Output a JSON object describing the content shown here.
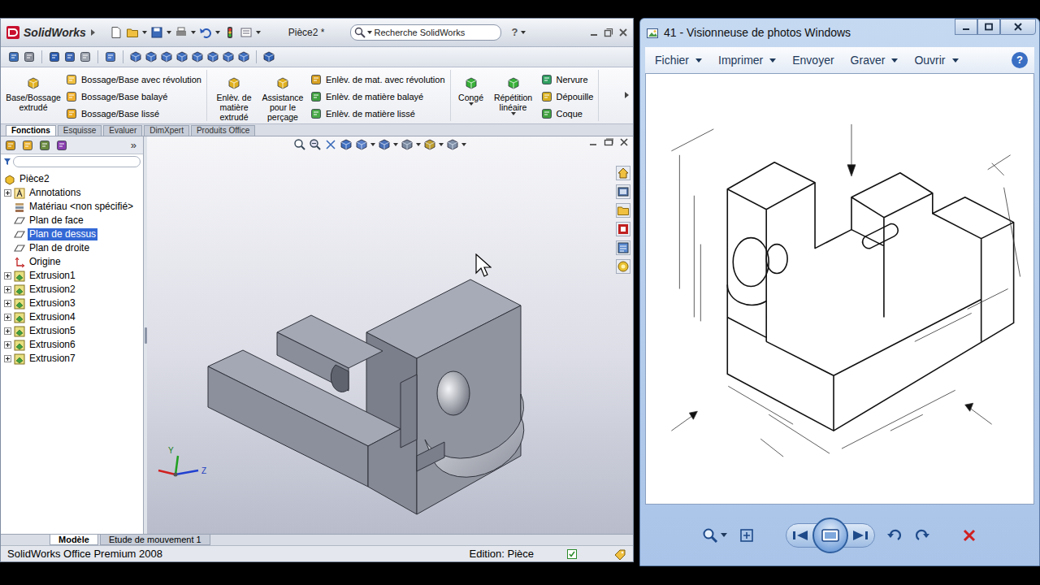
{
  "solidworks": {
    "logo": "SolidWorks",
    "document_title": "Pièce2 *",
    "search": {
      "placeholder": "Recherche SolidWorks"
    },
    "help": "?",
    "ribbon": [
      {
        "large": [
          "Base/Bossage extrudé"
        ],
        "small": [
          "Bossage/Base avec révolution",
          "Bossage/Base balayé",
          "Bossage/Base lissé"
        ]
      },
      {
        "large": [
          "Enlèv. de matière extrudé",
          "Assistance pour le perçage"
        ],
        "small": [
          "Enlèv. de mat. avec révolution",
          "Enlèv. de matière balayé",
          "Enlèv. de matière lissé"
        ]
      },
      {
        "large": [
          "Congé",
          "Répétition linéaire"
        ],
        "small": [
          "Nervure",
          "Dépouille",
          "Coque"
        ]
      }
    ],
    "tabs": [
      {
        "label": "Fonctions",
        "selected": true
      },
      {
        "label": "Esquisse",
        "selected": false
      },
      {
        "label": "Evaluer",
        "selected": false
      },
      {
        "label": "DimXpert",
        "selected": false
      },
      {
        "label": "Produits Office",
        "selected": false
      }
    ],
    "panel_more": "»",
    "feature_tree": {
      "root": "Pièce2",
      "items": [
        {
          "label": "Annotations",
          "kind": "annotations",
          "expandable": true,
          "selected": false
        },
        {
          "label": "Matériau <non spécifié>",
          "kind": "material",
          "expandable": false,
          "selected": false
        },
        {
          "label": "Plan de face",
          "kind": "plane",
          "expandable": false,
          "selected": false
        },
        {
          "label": "Plan de dessus",
          "kind": "plane",
          "expandable": false,
          "selected": true
        },
        {
          "label": "Plan de droite",
          "kind": "plane",
          "expandable": false,
          "selected": false
        },
        {
          "label": "Origine",
          "kind": "origin",
          "expandable": false,
          "selected": false
        },
        {
          "label": "Extrusion1",
          "kind": "feature",
          "expandable": true,
          "selected": false
        },
        {
          "label": "Extrusion2",
          "kind": "feature",
          "expandable": true,
          "selected": false
        },
        {
          "label": "Extrusion3",
          "kind": "feature",
          "expandable": true,
          "selected": false
        },
        {
          "label": "Extrusion4",
          "kind": "feature",
          "expandable": true,
          "selected": false
        },
        {
          "label": "Extrusion5",
          "kind": "feature",
          "expandable": true,
          "selected": false
        },
        {
          "label": "Extrusion6",
          "kind": "feature",
          "expandable": true,
          "selected": false
        },
        {
          "label": "Extrusion7",
          "kind": "feature",
          "expandable": true,
          "selected": false
        }
      ]
    },
    "triad": [
      "Y",
      "Z"
    ],
    "bottom_tabs": [
      {
        "label": "Modèle",
        "selected": true
      },
      {
        "label": "Etude de mouvement 1",
        "selected": false
      }
    ],
    "status_bar": {
      "product": "SolidWorks Office Premium 2008",
      "mode": "Edition: Pièce"
    }
  },
  "photo_viewer": {
    "title": "41 - Visionneuse de photos Windows",
    "menu": [
      {
        "label": "Fichier",
        "dropdown": true
      },
      {
        "label": "Imprimer",
        "dropdown": true
      },
      {
        "label": "Envoyer",
        "dropdown": false
      },
      {
        "label": "Graver",
        "dropdown": true
      },
      {
        "label": "Ouvrir",
        "dropdown": true
      }
    ],
    "help": "?"
  }
}
